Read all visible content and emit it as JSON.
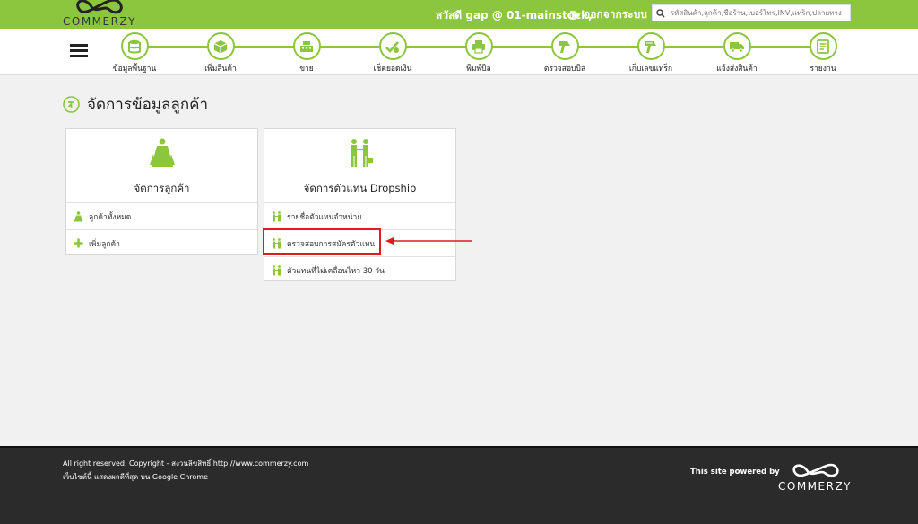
{
  "brand": {
    "name": "COMMERZY"
  },
  "header": {
    "greeting": "สวัสดี gap @ 01-mainstock,",
    "logout_label": "ออกจากระบบ",
    "search_placeholder": "รหัสสินค้า,ลูกค้า,ชื่อร้าน,เบอร์โทร,INV,แทร็ก,ปลายทาง"
  },
  "nav": {
    "items": [
      {
        "label": "ข้อมูลพื้นฐาน",
        "icon": "database-icon"
      },
      {
        "label": "เพิ่มสินค้า",
        "icon": "box-icon"
      },
      {
        "label": "ขาย",
        "icon": "cash-register-icon"
      },
      {
        "label": "เช็คยอดเงิน",
        "icon": "check-money-icon"
      },
      {
        "label": "พิมพ์บิล",
        "icon": "printer-icon"
      },
      {
        "label": "ตรวจสอบบิล",
        "icon": "scanner-icon"
      },
      {
        "label": "เก็บเลขแทร็ก",
        "icon": "tracking-scanner-icon"
      },
      {
        "label": "แจ้งส่งสินค้า",
        "icon": "truck-icon"
      },
      {
        "label": "รายงาน",
        "icon": "report-icon"
      }
    ]
  },
  "page": {
    "title": "จัดการข้อมูลลูกค้า"
  },
  "cards": {
    "customers": {
      "title": "จัดการลูกค้า",
      "items": [
        "ลูกค้าทั้งหมด",
        "เพิ่มลูกค้า"
      ]
    },
    "dropship": {
      "title": "จัดการตัวแทน Dropship",
      "items": [
        "รายชื่อตัวแทนจำหน่าย",
        "ตรวจสอบการสมัครตัวแทน",
        "ตัวแทนที่ไม่เคลื่อนไหว 30 วัน"
      ]
    }
  },
  "footer": {
    "copyright": "All right reserved. Copyright - สงวนลิขสิทธิ์ http://www.commerzy.com",
    "browser_note": "เว็บไซต์นี้ แสดงผลดีที่สุด บน Google Chrome",
    "powered_by": "This site powered by",
    "logo_text": "COMMERZY"
  },
  "colors": {
    "accent": "#8cc63f",
    "highlight": "#e01b1b",
    "footer_bg": "#2b2b2b"
  }
}
